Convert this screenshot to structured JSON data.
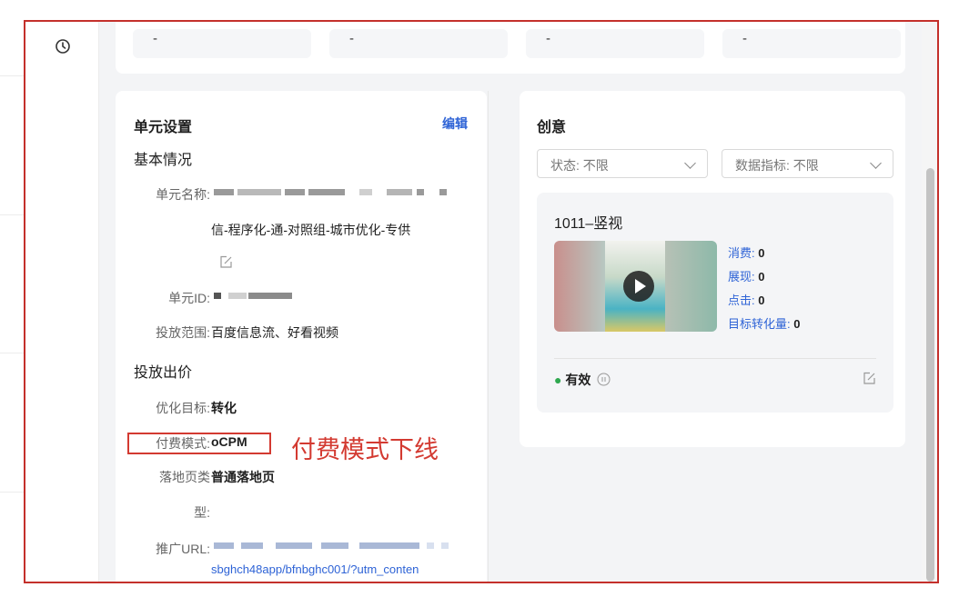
{
  "top_stats": [
    "-",
    "-",
    "-",
    "-"
  ],
  "unit_settings": {
    "title": "单元设置",
    "edit_label": "编辑",
    "basic_section": "基本情况",
    "unit_name_label": "单元名称:",
    "unit_name_value": "信-程序化-通-对照组-城市优化-专供",
    "unit_id_label": "单元ID:",
    "placement_label": "投放范围:",
    "placement_value": "百度信息流、好看视频",
    "bid_section": "投放出价",
    "goal_label": "优化目标:",
    "goal_value": "转化",
    "pay_mode_label": "付费模式:",
    "pay_mode_value": "oCPM",
    "landing_label": "落地页类",
    "landing_label_2": "型:",
    "landing_value": "普通落地页",
    "url_label": "推广URL:",
    "url_value": "sbghch48app/bfnbghc001/?utm_conten"
  },
  "creative": {
    "title": "创意",
    "status_filter": "状态:  不限",
    "metric_filter": "数据指标:  不限",
    "card_title": "1011–竖视",
    "metrics": [
      {
        "label": "消费:",
        "value": "0"
      },
      {
        "label": "展现:",
        "value": "0"
      },
      {
        "label": "点击:",
        "value": "0"
      },
      {
        "label": "目标转化量:",
        "value": "0"
      }
    ],
    "status_text": "有效"
  },
  "annotation": "付费模式下线",
  "colors": {
    "accent": "#2e63d6",
    "annotation": "#d33a31",
    "status": "#2fa84f"
  }
}
